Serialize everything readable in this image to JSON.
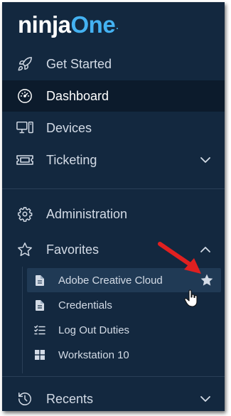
{
  "logo": {
    "ninja": "ninja",
    "one": "One",
    "dot": "."
  },
  "nav": {
    "get_started": "Get Started",
    "dashboard": "Dashboard",
    "devices": "Devices",
    "ticketing": "Ticketing",
    "administration": "Administration",
    "favorites": "Favorites",
    "recents": "Recents"
  },
  "favorites": [
    {
      "label": "Adobe Creative Cloud",
      "icon": "document-icon",
      "starred": true
    },
    {
      "label": "Credentials",
      "icon": "document-icon"
    },
    {
      "label": "Log Out Duties",
      "icon": "checklist-icon"
    },
    {
      "label": "Workstation 10",
      "icon": "windows-icon"
    }
  ],
  "colors": {
    "sidebar_bg": "#13283f",
    "active_bg": "#0c1b2c",
    "hover_bg": "#203a55",
    "accent": "#44b2f2",
    "annotation_arrow": "#e02020"
  }
}
